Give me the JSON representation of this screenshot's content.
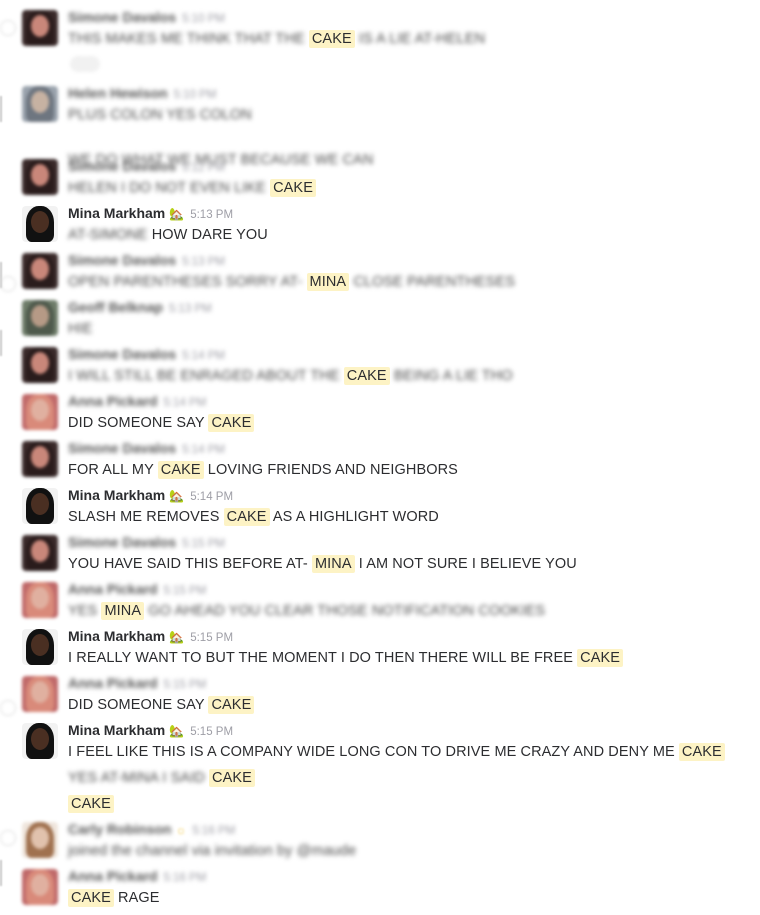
{
  "colors": {
    "highlight_bg": "#fdf3c5",
    "text": "#2c2d30",
    "timestamp": "#9e9ea6"
  },
  "messages": [
    {
      "user": "Simone Davalos",
      "time": "5:10 PM",
      "blurred_header": true,
      "avatar": "simone",
      "lines": [
        [
          {
            "t": "THIS MAKES ME THINK THAT THE",
            "b": 1
          },
          {
            "t": "CAKE",
            "h": 1
          },
          {
            "t": "IS A LIE AT-HELEN",
            "b": 1
          }
        ]
      ],
      "reaction": "lock-reaction"
    },
    {
      "user": "Helen Hewison",
      "time": "5:10 PM",
      "blurred_header": true,
      "avatar": "helen",
      "lines": [
        [
          {
            "t": "PLUS COLON YES COLON",
            "b": 1
          }
        ],
        [
          {
            "t": "WE DO WHAT WE MUST BECAUSE WE CAN",
            "b": 1
          }
        ]
      ]
    },
    {
      "user": "Simone Davalos",
      "time": "5:12 PM",
      "blurred_header": true,
      "avatar": "simone",
      "lines": [
        [
          {
            "t": "HELEN I DO NOT EVEN LIKE",
            "b": 1
          },
          {
            "t": "CAKE",
            "h": 1
          }
        ]
      ]
    },
    {
      "user": "Mina Markham",
      "time": "5:13 PM",
      "blurred_header": false,
      "avatar": "mina",
      "status_icon": "house-status-icon",
      "lines": [
        [
          {
            "t": "AT-SIMONE",
            "b": 1
          },
          {
            "t": "HOW DARE YOU"
          }
        ]
      ]
    },
    {
      "user": "Simone Davalos",
      "time": "5:13 PM",
      "blurred_header": true,
      "avatar": "simone",
      "lines": [
        [
          {
            "t": "OPEN PARENTHESES SORRY AT-",
            "b": 1
          },
          {
            "t": "MINA",
            "h": 1
          },
          {
            "t": "CLOSE PARENTHESES",
            "b": 1
          }
        ]
      ]
    },
    {
      "user": "Geoff Belknap",
      "time": "5:13 PM",
      "blurred_header": true,
      "avatar": "geoff",
      "lines": [
        [
          {
            "t": "HIE",
            "b": 1
          }
        ]
      ]
    },
    {
      "user": "Simone Davalos",
      "time": "5:14 PM",
      "blurred_header": true,
      "avatar": "simone",
      "lines": [
        [
          {
            "t": "I WILL STILL BE ENRAGED ABOUT THE",
            "b": 1
          },
          {
            "t": "CAKE",
            "h": 1
          },
          {
            "t": "BEING A LIE THO",
            "b": 1
          }
        ]
      ]
    },
    {
      "user": "Anna Pickard",
      "time": "5:14 PM",
      "blurred_header": true,
      "avatar": "anna",
      "lines": [
        [
          {
            "t": "DID SOMEONE SAY"
          },
          {
            "t": "CAKE",
            "h": 1
          }
        ]
      ]
    },
    {
      "user": "Simone Davalos",
      "time": "5:14 PM",
      "blurred_header": true,
      "avatar": "simone",
      "lines": [
        [
          {
            "t": "FOR ALL MY"
          },
          {
            "t": "CAKE",
            "h": 1
          },
          {
            "t": "LOVING FRIENDS AND NEIGHBORS"
          }
        ]
      ]
    },
    {
      "user": "Mina Markham",
      "time": "5:14 PM",
      "blurred_header": false,
      "avatar": "mina",
      "status_icon": "house-status-icon",
      "lines": [
        [
          {
            "t": "SLASH ME REMOVES"
          },
          {
            "t": "CAKE",
            "h": 1
          },
          {
            "t": "AS A HIGHLIGHT WORD"
          }
        ]
      ]
    },
    {
      "user": "Simone Davalos",
      "time": "5:15 PM",
      "blurred_header": true,
      "avatar": "simone",
      "lines": [
        [
          {
            "t": "YOU HAVE SAID THIS BEFORE AT-"
          },
          {
            "t": "MINA",
            "h": 1
          },
          {
            "t": "I AM NOT SURE I BELIEVE YOU"
          }
        ]
      ]
    },
    {
      "user": "Anna Pickard",
      "time": "5:15 PM",
      "blurred_header": true,
      "avatar": "anna",
      "lines": [
        [
          {
            "t": "YES",
            "b": 1
          },
          {
            "t": "MINA",
            "h": 1
          },
          {
            "t": "GO AHEAD YOU CLEAR THOSE NOTIFICATION COOKIES",
            "b": 1
          }
        ]
      ]
    },
    {
      "user": "Mina Markham",
      "time": "5:15 PM",
      "blurred_header": false,
      "avatar": "mina",
      "status_icon": "house-status-icon",
      "lines": [
        [
          {
            "t": "I REALLY WANT TO BUT THE MOMENT I DO THEN THERE WILL BE FREE"
          },
          {
            "t": "CAKE",
            "h": 1
          }
        ]
      ]
    },
    {
      "user": "Anna Pickard",
      "time": "5:15 PM",
      "blurred_header": true,
      "avatar": "anna",
      "lines": [
        [
          {
            "t": "DID SOMEONE SAY"
          },
          {
            "t": "CAKE",
            "h": 1
          }
        ]
      ]
    },
    {
      "user": "Mina Markham",
      "time": "5:15 PM",
      "blurred_header": false,
      "avatar": "mina",
      "status_icon": "house-status-icon",
      "lines": [
        [
          {
            "t": "I FEEL LIKE THIS IS A COMPANY WIDE LONG CON TO DRIVE ME CRAZY AND DENY ME"
          },
          {
            "t": "CAKE",
            "h": 1
          }
        ],
        [
          {
            "t": "YES AT-MINA I SAID",
            "b": 1
          },
          {
            "t": "CAKE",
            "h": 1
          }
        ],
        [
          {
            "t": "CAKE",
            "h": 1
          }
        ]
      ]
    },
    {
      "user": "Carly Robinson",
      "time": "5:16 PM",
      "blurred_header": true,
      "avatar": "carly",
      "status_icon": "sun-status-icon",
      "lines": [
        [
          {
            "t": "joined the channel via invitation by @maude",
            "b": 1
          }
        ]
      ]
    },
    {
      "user": "Anna Pickard",
      "time": "5:16 PM",
      "blurred_header": true,
      "avatar": "anna",
      "lines": [
        [
          {
            "t": "CAKE",
            "h": 1
          },
          {
            "t": "RAGE"
          }
        ]
      ]
    }
  ]
}
